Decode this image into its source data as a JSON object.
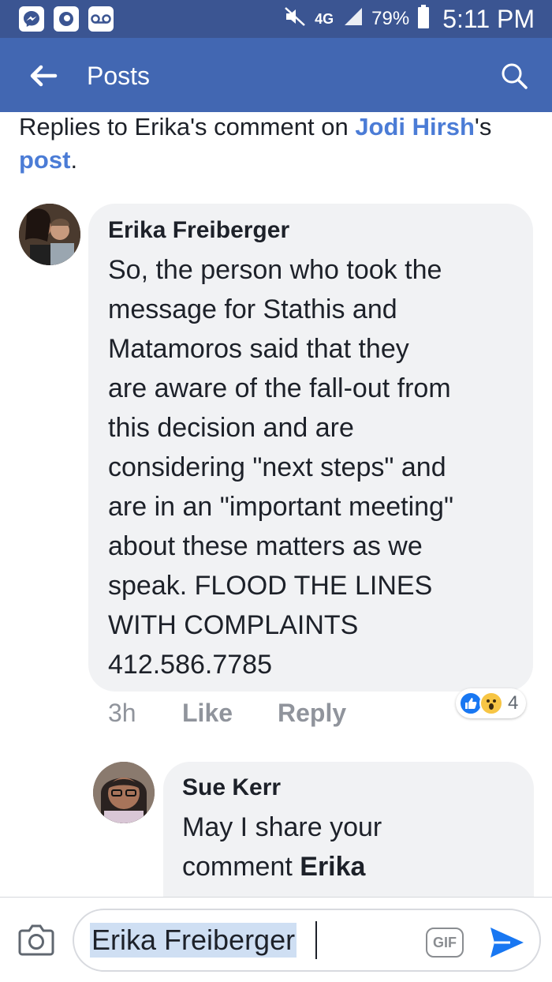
{
  "status_bar": {
    "left_icons": [
      "messenger-icon",
      "app-icon",
      "voicemail-icon"
    ],
    "network": "4G",
    "battery_percent": "79%",
    "time": "5:11 PM"
  },
  "app_bar": {
    "title": "Posts"
  },
  "context": {
    "prefix": "Replies to Erika's comment on ",
    "person_link": "Jodi Hirsh",
    "possessive": "'s ",
    "post_link": "post",
    "suffix": "."
  },
  "comment": {
    "author": "Erika Freiberger",
    "text": "So, the person who took the\nmessage for Stathis and\nMatamoros said that they\nare aware of the fall-out from\nthis decision and are\nconsidering \"next steps\" and\nare in an \"important meeting\"\nabout these matters as we\nspeak.  FLOOD THE LINES\nWITH COMPLAINTS\n412.586.7785",
    "time": "3h",
    "like_label": "Like",
    "reply_label": "Reply",
    "reaction_count": "4"
  },
  "reply": {
    "author": "Sue Kerr",
    "text_prefix": "May I share your\ncomment ",
    "text_mention": "Erika"
  },
  "composer": {
    "input_value": "Erika Freiberger",
    "gif_label": "GIF"
  }
}
